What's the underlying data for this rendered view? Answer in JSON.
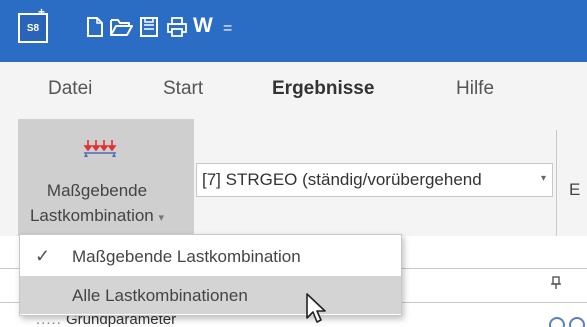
{
  "title_bar": {
    "app_icon_text": "S8",
    "app_icon_badge": "+",
    "quick_access": [
      "new-document-icon",
      "open-folder-icon",
      "save-icon",
      "print-icon"
    ],
    "word_button_label": "W",
    "customize_label": "="
  },
  "ribbon": {
    "tabs": [
      {
        "label": "Datei"
      },
      {
        "label": "Start"
      },
      {
        "label": "Ergebnisse",
        "active": true
      },
      {
        "label": "Hilfe"
      }
    ],
    "load_case_button": {
      "label_line1": "Maßgebende",
      "label_line2": "Lastkombination",
      "caret": "▾"
    },
    "combo": {
      "value": "[7] STRGEO (ständig/vorübergehend",
      "arrow": "▾"
    },
    "truncated_label": "E"
  },
  "dropdown_menu": {
    "items": [
      {
        "label": "Maßgebende Lastkombination",
        "checked": true,
        "check": "✓"
      },
      {
        "label": "Alle Lastkombinationen",
        "checked": false,
        "highlighted": true
      }
    ]
  },
  "panel": {
    "pin_glyph": "ꟷ",
    "tree_item": "Grundparameter",
    "tree_prefix": "....."
  },
  "colors": {
    "title_bar": "#2b6cc4",
    "ribbon_bg": "#f4f4f4",
    "tab_underline": "#2b6cc4",
    "selected_button_bg": "#cfcfcf",
    "menu_highlight": "#d4d4d4",
    "load_arrows": "#e23030"
  }
}
